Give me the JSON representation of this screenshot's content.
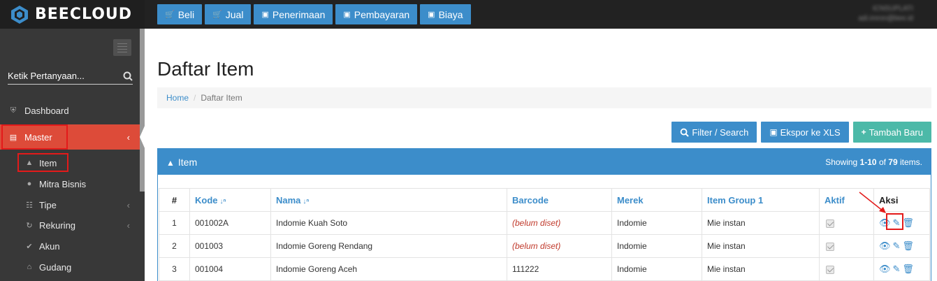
{
  "app": {
    "logo_text": "BEECLOUD"
  },
  "topnav": [
    {
      "label": "Beli",
      "icon": "cart-icon"
    },
    {
      "label": "Jual",
      "icon": "cart-icon"
    },
    {
      "label": "Penerimaan",
      "icon": "money-icon"
    },
    {
      "label": "Pembayaran",
      "icon": "money-icon"
    },
    {
      "label": "Biaya",
      "icon": "money-icon"
    }
  ],
  "user": {
    "name": "ICNSUPLATI",
    "email": "adi.imron@bee.id"
  },
  "sidebar": {
    "search_placeholder": "Ketik Pertanyaan...",
    "items": [
      {
        "label": "Dashboard",
        "icon": "dashboard-icon"
      },
      {
        "label": "Master",
        "icon": "database-icon",
        "active": true
      },
      {
        "label": "Item",
        "icon": "cube-icon"
      },
      {
        "label": "Mitra Bisnis",
        "icon": "users-icon"
      },
      {
        "label": "Tipe",
        "icon": "sitemap-icon"
      },
      {
        "label": "Rekuring",
        "icon": "refresh-icon"
      },
      {
        "label": "Akun",
        "icon": "check-icon"
      },
      {
        "label": "Gudang",
        "icon": "home-icon"
      }
    ]
  },
  "page": {
    "title": "Daftar Item",
    "breadcrumb": {
      "home": "Home",
      "current": "Daftar Item"
    }
  },
  "actions": {
    "filter": "Filter / Search",
    "export": "Ekspor ke XLS",
    "add": "Tambah Baru"
  },
  "panel": {
    "title": "Item",
    "showing_prefix": "Showing ",
    "showing_range": "1-10",
    "showing_of": " of ",
    "showing_total": "79",
    "showing_suffix": " items."
  },
  "table": {
    "headers": [
      "#",
      "Kode",
      "Nama",
      "Barcode",
      "Merek",
      "Item Group 1",
      "Aktif",
      "Aksi"
    ],
    "rows": [
      {
        "no": "1",
        "kode": "001002A",
        "nama": "Indomie Kuah Soto",
        "barcode": "(belum diset)",
        "barcode_empty": true,
        "merek": "Indomie",
        "group": "Mie instan",
        "aktif": true
      },
      {
        "no": "2",
        "kode": "001003",
        "nama": "Indomie Goreng Rendang",
        "barcode": "(belum diset)",
        "barcode_empty": true,
        "merek": "Indomie",
        "group": "Mie instan",
        "aktif": true
      },
      {
        "no": "3",
        "kode": "001004",
        "nama": "Indomie Goreng Aceh",
        "barcode": "111222",
        "barcode_empty": false,
        "merek": "Indomie",
        "group": "Mie instan",
        "aktif": true
      }
    ]
  },
  "colors": {
    "primary": "#3c8dca",
    "danger": "#dd4b39",
    "success": "#4cb9a8",
    "sidebar": "#383838",
    "topbar": "#222222",
    "annotation": "#e31a1a"
  }
}
